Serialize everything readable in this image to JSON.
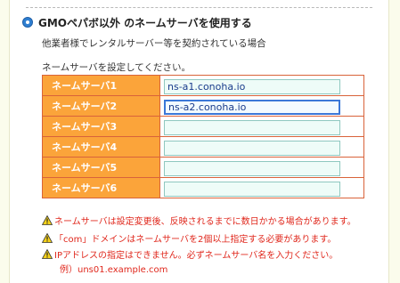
{
  "option": {
    "title": "GMOペパボ以外 のネームサーバを使用する",
    "description": "他業者様でレンタルサーバー等を契約されている場合",
    "prompt": "ネームサーバを設定してください。"
  },
  "nameservers": [
    {
      "label": "ネームサーバ1",
      "value": "ns-a1.conoha.io"
    },
    {
      "label": "ネームサーバ2",
      "value": "ns-a2.conoha.io"
    },
    {
      "label": "ネームサーバ3",
      "value": ""
    },
    {
      "label": "ネームサーバ4",
      "value": ""
    },
    {
      "label": "ネームサーバ5",
      "value": ""
    },
    {
      "label": "ネームサーバ6",
      "value": ""
    }
  ],
  "warnings": [
    "ネームサーバは設定変更後、反映されるまでに数日かかる場合があります。",
    "「com」ドメインはネームサーバを2個以上指定する必要があります。",
    "IPアドレスの指定はできません。必ずネームサーバ名を入力ください。"
  ],
  "example": "例）uns01.example.com",
  "colors": {
    "label_bg": "#fba43a",
    "border": "#d9633a",
    "warning": "#e0281d",
    "radio": "#2f7fd1"
  }
}
